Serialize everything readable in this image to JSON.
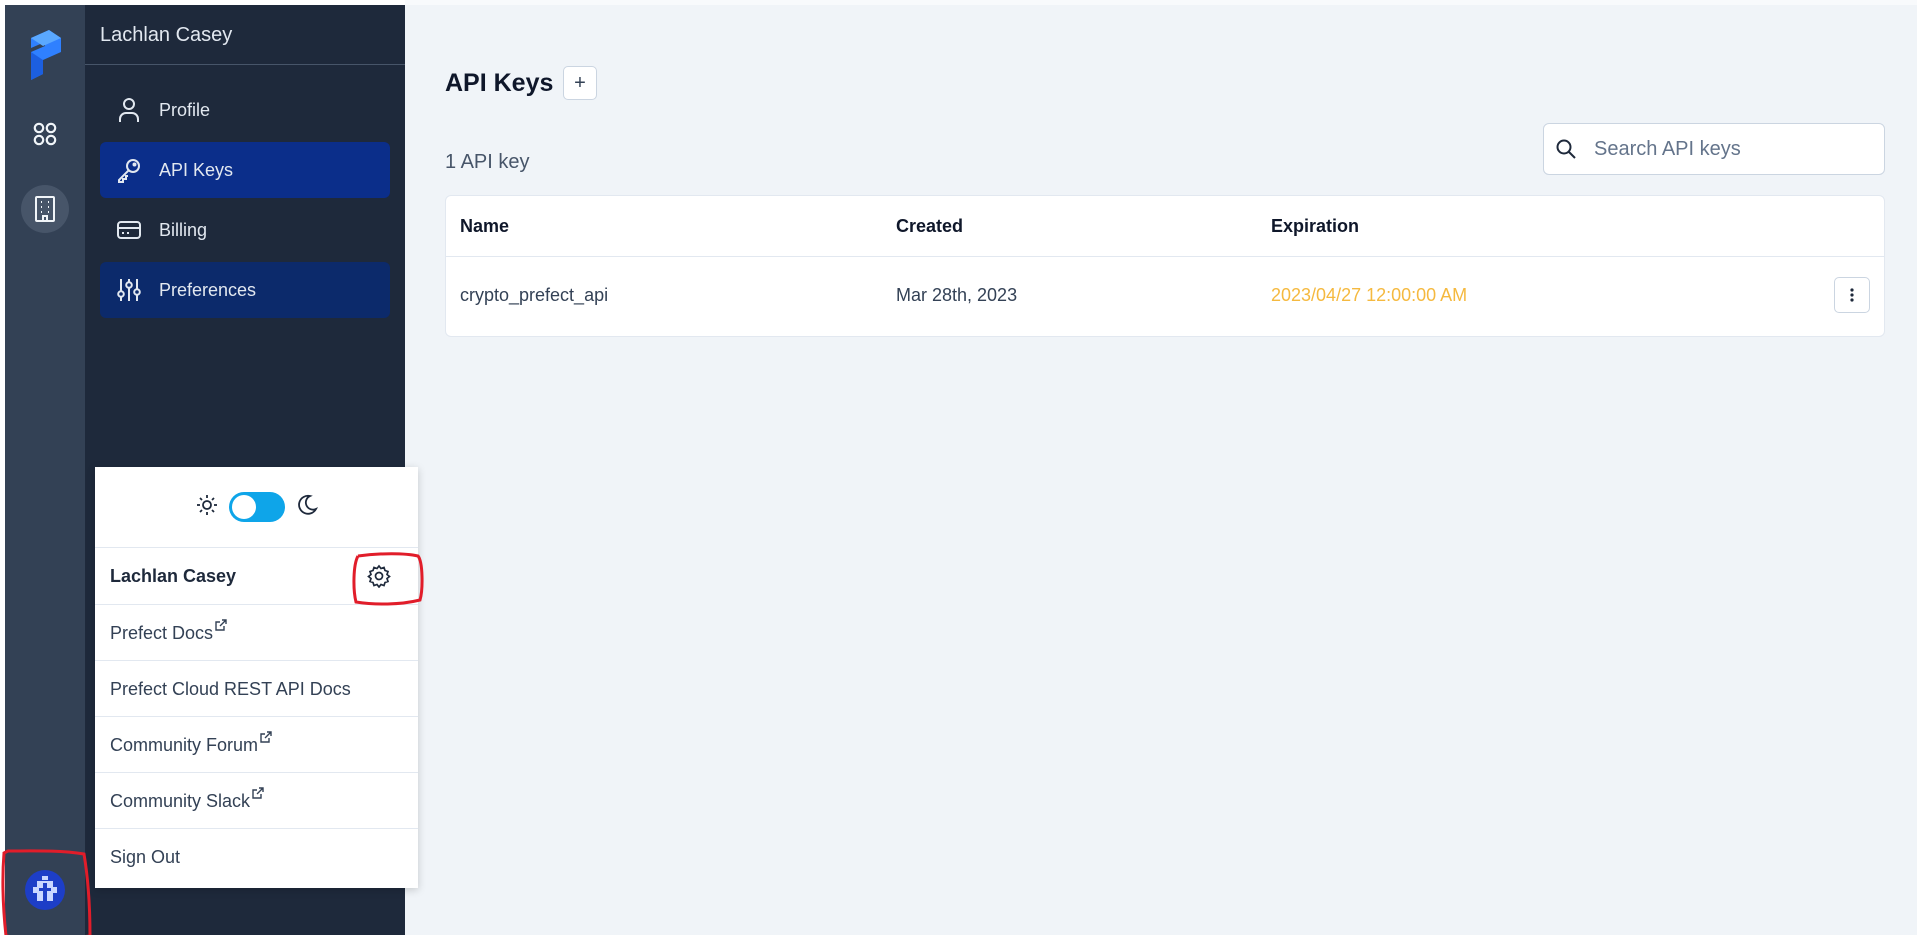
{
  "rail": {
    "logo_icon": "prefect-logo",
    "dashboard_icon": "grid-icon",
    "organization_icon": "building-icon",
    "avatar_icon": "user-avatar"
  },
  "sidebar": {
    "header": "Lachlan Casey",
    "items": [
      {
        "label": "Profile",
        "icon": "person-icon"
      },
      {
        "label": "API Keys",
        "icon": "key-icon"
      },
      {
        "label": "Billing",
        "icon": "credit-card-icon"
      },
      {
        "label": "Preferences",
        "icon": "sliders-icon"
      }
    ]
  },
  "main": {
    "title": "API Keys",
    "add_label": "+",
    "count_text": "1 API key",
    "search_placeholder": "Search API keys",
    "table": {
      "headers": [
        "Name",
        "Created",
        "Expiration"
      ],
      "rows": [
        {
          "name": "crypto_prefect_api",
          "created": "Mar 28th, 2023",
          "expiration": "2023/04/27 12:00:00 AM"
        }
      ]
    }
  },
  "popup": {
    "user_name": "Lachlan Casey",
    "items": [
      {
        "label": "Prefect Docs",
        "external": true
      },
      {
        "label": "Prefect Cloud REST API Docs",
        "external": false
      },
      {
        "label": "Community Forum",
        "external": true
      },
      {
        "label": "Community Slack",
        "external": true
      },
      {
        "label": "Sign Out",
        "external": false
      }
    ]
  },
  "colors": {
    "accent": "#0b2e8a",
    "rail": "#334155",
    "sidebar": "#1e293b",
    "expiration_warning": "#f5b93f",
    "toggle": "#0ea5e9",
    "annotation": "#e11d2a"
  }
}
